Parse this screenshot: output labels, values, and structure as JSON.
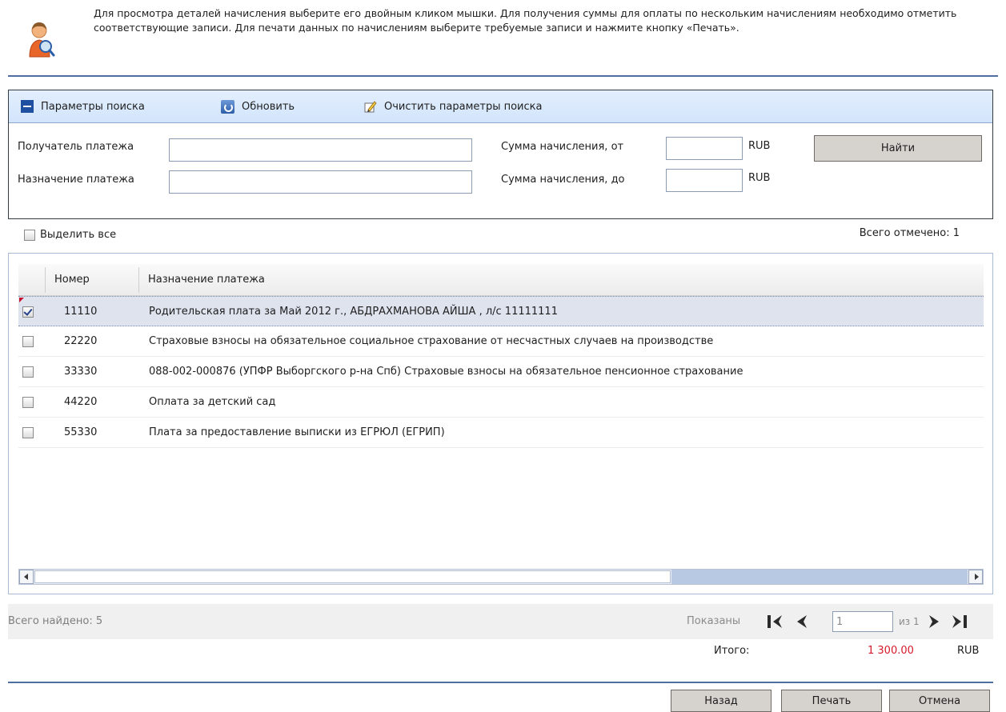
{
  "info": {
    "text": "Для просмотра деталей начисления выберите его двойным кликом мышки. Для получения суммы для оплаты по нескольким начислениям необходимо отметить соответствующие записи. Для печати данных по начислениям выберите требуемые записи и нажмите кнопку «Печать».",
    "icon": "user-search-icon"
  },
  "search": {
    "toolbar": {
      "collapse_label": "Параметры поиска",
      "refresh_label": "Обновить",
      "clear_label": "Очистить параметры поиска"
    },
    "recipient_label": "Получатель платежа",
    "recipient_value": "",
    "purpose_label": "Назначение платежа",
    "purpose_value": "",
    "amount_from_label": "Сумма начисления, от",
    "amount_from_value": "",
    "amount_to_label": "Сумма начисления, до",
    "amount_to_value": "",
    "currency": "RUB",
    "find_label": "Найти"
  },
  "selection": {
    "select_all_label": "Выделить все",
    "select_all_checked": false,
    "marked_total": "Всего отмечено: 1"
  },
  "grid": {
    "columns": [
      "Номер",
      "Назначение платежа"
    ],
    "rows": [
      {
        "checked": true,
        "number": "11110",
        "purpose": "Родительская плата за Май 2012 г., АБДРАХМАНОВА АЙША , л/с 11111111"
      },
      {
        "checked": false,
        "number": "22220",
        "purpose": "Страховые взносы на обязательное социальное страхование от несчастных случаев на производстве"
      },
      {
        "checked": false,
        "number": "33330",
        "purpose": "088-002-000876 (УПФР Выборгского р-на Спб) Страховые взносы на обязательное пенсионное страхование"
      },
      {
        "checked": false,
        "number": "44220",
        "purpose": "Оплата за детский сад"
      },
      {
        "checked": false,
        "number": "55330",
        "purpose": "Плата за предоставление выписки из ЕГРЮЛ (ЕГРИП)"
      }
    ]
  },
  "pager": {
    "found": "Всего найдено: 5",
    "shown_label": "Показаны",
    "page_value": "1",
    "page_of": "из 1"
  },
  "totals": {
    "label": "Итого:",
    "value": "1 300.00",
    "currency": "RUB"
  },
  "actions": {
    "back_label": "Назад",
    "print_label": "Печать",
    "cancel_label": "Отмена"
  },
  "colors": {
    "accent_rule": "#4f6fa0",
    "total_value": "#d41a2a",
    "toolbar_bg": "#d2e4fb"
  }
}
